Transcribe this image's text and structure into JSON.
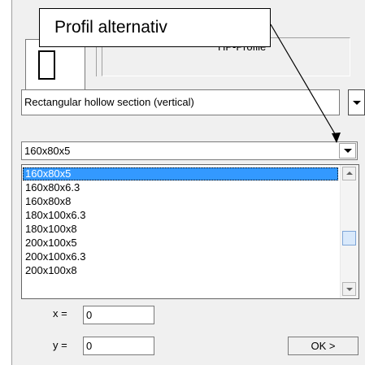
{
  "preview": {
    "name_text": "HP-Profile"
  },
  "section_combo": {
    "value": "Rectangular hollow section  (vertical)",
    "button_icon": "chevron-down-icon"
  },
  "size_combo": {
    "value": "160x80x5",
    "button_icon": "chevron-down-icon"
  },
  "dropdown": {
    "items": [
      "160x80x5",
      "160x80x6.3",
      "160x80x8",
      "180x100x6.3",
      "180x100x8",
      "200x100x5",
      "200x100x6.3",
      "200x100x8"
    ],
    "selected_index": 0,
    "scroll_position": 0.6
  },
  "coords": {
    "x_label": "x =",
    "x_value": "0",
    "y_label": "y =",
    "y_value": "0"
  },
  "ok_button": "OK >",
  "callout": {
    "text": "Profil alternativ"
  }
}
